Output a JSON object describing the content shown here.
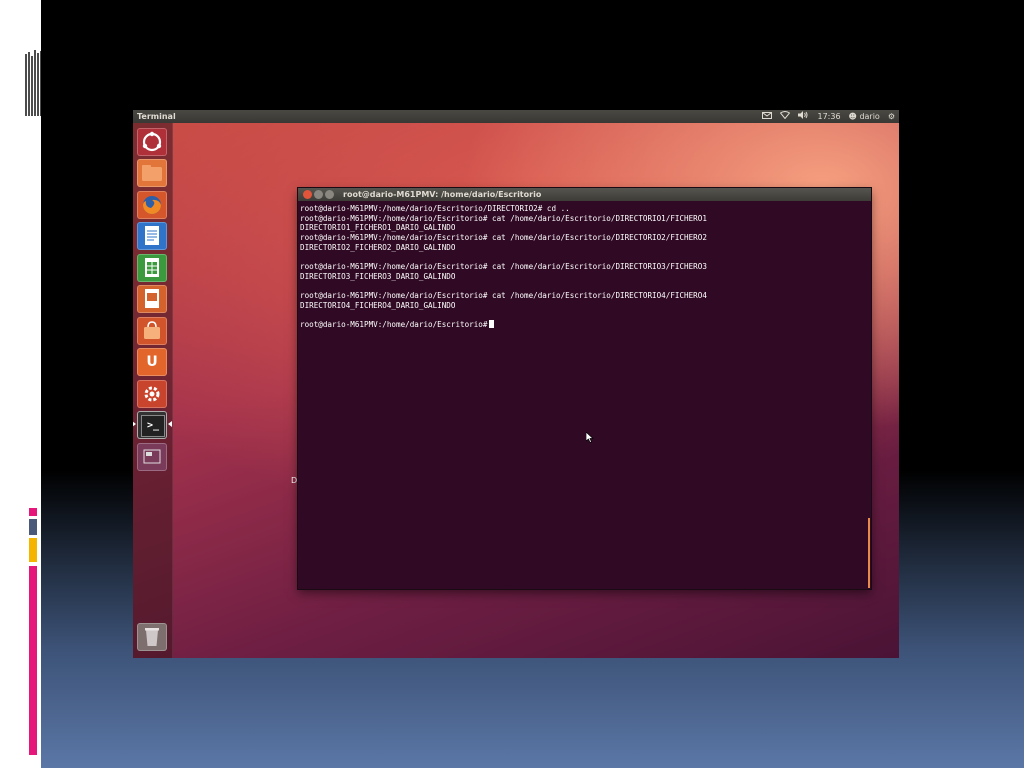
{
  "slide": {
    "accent_colors": [
      "#e6177b",
      "#4a5a78",
      "#f5b400",
      "#e6177b"
    ]
  },
  "topbar": {
    "app_title": "Terminal",
    "time": "17:36",
    "user": "dario",
    "icons": [
      "mail-icon",
      "wifi-icon",
      "volume-icon",
      "user-icon",
      "gear-icon"
    ]
  },
  "launcher": {
    "items": [
      {
        "name": "dash-home",
        "icon": "ubuntu-logo-icon",
        "color": "#b0303a"
      },
      {
        "name": "files",
        "icon": "folder-icon",
        "color": "#e2763a"
      },
      {
        "name": "firefox",
        "icon": "firefox-icon",
        "color": "#d5562a"
      },
      {
        "name": "writer",
        "icon": "document-icon",
        "color": "#2f74c8"
      },
      {
        "name": "calc",
        "icon": "spreadsheet-icon",
        "color": "#3b9a3e"
      },
      {
        "name": "impress",
        "icon": "presentation-icon",
        "color": "#d3622c"
      },
      {
        "name": "software-center",
        "icon": "shopping-bag-icon",
        "color": "#d2542b"
      },
      {
        "name": "ubuntu-one",
        "icon": "ubuntu-one-icon",
        "color": "#e2662c",
        "glyph": "U"
      },
      {
        "name": "system-settings",
        "icon": "settings-icon",
        "color": "#c9442c"
      },
      {
        "name": "terminal",
        "icon": "terminal-icon",
        "color": "#333333",
        "glyph": ">_"
      },
      {
        "name": "workspaces",
        "icon": "workspace-switcher-icon",
        "color": "#7a3a5a"
      }
    ],
    "trash": {
      "name": "trash",
      "icon": "trash-icon",
      "color": "#7e6f6f"
    }
  },
  "desktop": {
    "partial_label": "Di"
  },
  "terminal": {
    "title": "root@dario-M61PMV: /home/dario/Escritorio",
    "lines": [
      "root@dario-M61PMV:/home/dario/Escritorio/DIRECTORIO2# cd ..",
      "root@dario-M61PMV:/home/dario/Escritorio# cat /home/dario/Escritorio/DIRECTORIO1/FICHERO1",
      "DIRECTORIO1_FICHERO1_DARIO_GALINDO",
      "root@dario-M61PMV:/home/dario/Escritorio# cat /home/dario/Escritorio/DIRECTORIO2/FICHERO2",
      "DIRECTORIO2_FICHERO2_DARIO_GALINDO",
      "",
      "root@dario-M61PMV:/home/dario/Escritorio# cat /home/dario/Escritorio/DIRECTORIO3/FICHERO3",
      "DIRECTORIO3_FICHERO3_DARIO_GALINDO",
      "",
      "root@dario-M61PMV:/home/dario/Escritorio# cat /home/dario/Escritorio/DIRECTORIO4/FICHERO4",
      "DIRECTORIO4_FICHERO4_DARIO_GALINDO",
      ""
    ],
    "prompt": "root@dario-M61PMV:/home/dario/Escritorio#",
    "window_buttons": {
      "close": "#e2553a",
      "minimize": "#8a8781",
      "maximize": "#8a8781"
    }
  }
}
